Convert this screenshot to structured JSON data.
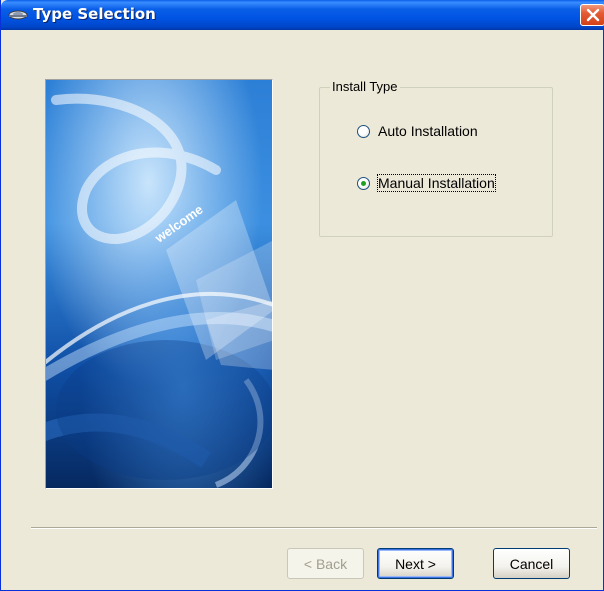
{
  "window": {
    "title": "Type Selection",
    "title_icon": "disc-drive-icon",
    "close_icon": "close-icon"
  },
  "banner": {
    "text": "welcome"
  },
  "install_type": {
    "legend": "Install Type",
    "options": [
      {
        "label": "Auto Installation",
        "selected": false
      },
      {
        "label": "Manual Installation",
        "selected": true
      }
    ]
  },
  "buttons": {
    "back": "< Back",
    "next": "Next >",
    "cancel": "Cancel"
  },
  "colors": {
    "titlebar": "#0054E3",
    "dialog_bg": "#ECE9D8",
    "close": "#E45B34"
  }
}
